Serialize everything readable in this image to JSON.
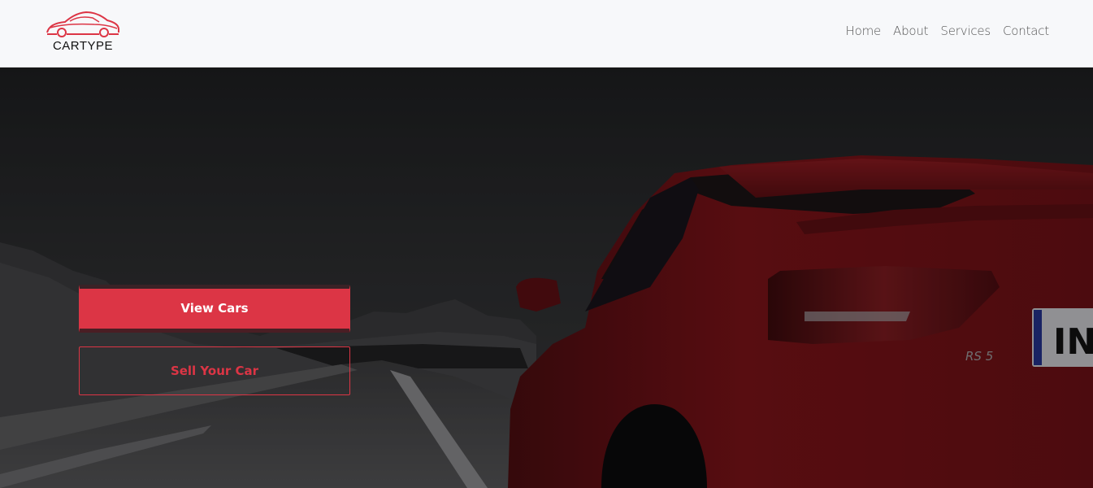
{
  "brand": {
    "name": "CARTYPE",
    "accent_color": "#dc3545"
  },
  "nav": {
    "items": [
      {
        "label": "Home"
      },
      {
        "label": "About"
      },
      {
        "label": "Services"
      },
      {
        "label": "Contact"
      }
    ]
  },
  "hero": {
    "primary_button": "View Cars",
    "secondary_button": "Sell Your Car",
    "plate_text": "IN",
    "badge_text": "RS 5"
  }
}
